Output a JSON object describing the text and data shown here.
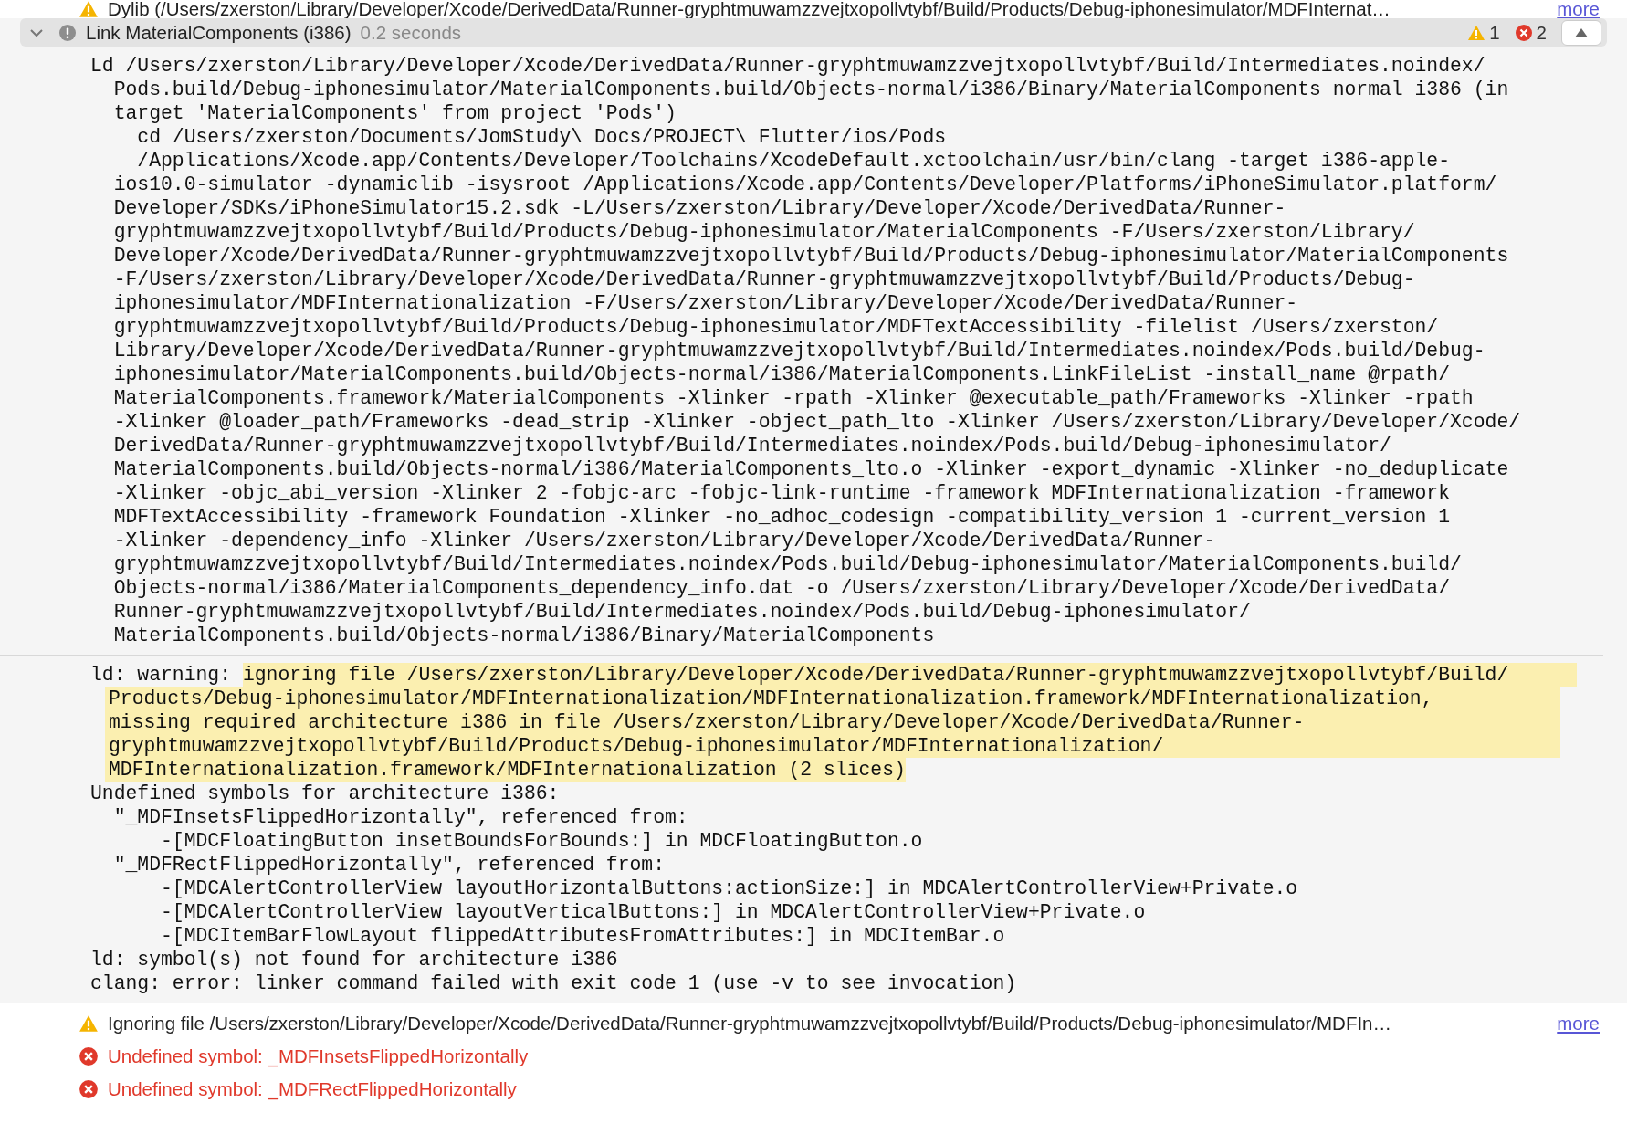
{
  "top_issue": {
    "kind": "warning",
    "text": "Dylib (/Users/zxerston/Library/Developer/Xcode/DerivedData/Runner-gryphtmuwamzzvejtxopollvtybf/Build/Products/Debug-iphonesimulator/MDFInternat…",
    "link": "more"
  },
  "step": {
    "expanded": true,
    "title": "Link MaterialComponents (i386)",
    "duration": "0.2 seconds",
    "warning_count": "1",
    "error_count": "2"
  },
  "command": {
    "lines": [
      "Ld /Users/zxerston/Library/Developer/Xcode/DerivedData/Runner-gryphtmuwamzzvejtxopollvtybf/Build/Intermediates.noindex/",
      "  Pods.build/Debug-iphonesimulator/MaterialComponents.build/Objects-normal/i386/Binary/MaterialComponents normal i386 (in",
      "  target 'MaterialComponents' from project 'Pods')",
      "    cd /Users/zxerston/Documents/JomStudy\\ Docs/PROJECT\\ Flutter/ios/Pods",
      "    /Applications/Xcode.app/Contents/Developer/Toolchains/XcodeDefault.xctoolchain/usr/bin/clang -target i386-apple-",
      "  ios10.0-simulator -dynamiclib -isysroot /Applications/Xcode.app/Contents/Developer/Platforms/iPhoneSimulator.platform/",
      "  Developer/SDKs/iPhoneSimulator15.2.sdk -L/Users/zxerston/Library/Developer/Xcode/DerivedData/Runner-",
      "  gryphtmuwamzzvejtxopollvtybf/Build/Products/Debug-iphonesimulator/MaterialComponents -F/Users/zxerston/Library/",
      "  Developer/Xcode/DerivedData/Runner-gryphtmuwamzzvejtxopollvtybf/Build/Products/Debug-iphonesimulator/MaterialComponents",
      "  -F/Users/zxerston/Library/Developer/Xcode/DerivedData/Runner-gryphtmuwamzzvejtxopollvtybf/Build/Products/Debug-",
      "  iphonesimulator/MDFInternationalization -F/Users/zxerston/Library/Developer/Xcode/DerivedData/Runner-",
      "  gryphtmuwamzzvejtxopollvtybf/Build/Products/Debug-iphonesimulator/MDFTextAccessibility -filelist /Users/zxerston/",
      "  Library/Developer/Xcode/DerivedData/Runner-gryphtmuwamzzvejtxopollvtybf/Build/Intermediates.noindex/Pods.build/Debug-",
      "  iphonesimulator/MaterialComponents.build/Objects-normal/i386/MaterialComponents.LinkFileList -install_name @rpath/",
      "  MaterialComponents.framework/MaterialComponents -Xlinker -rpath -Xlinker @executable_path/Frameworks -Xlinker -rpath",
      "  -Xlinker @loader_path/Frameworks -dead_strip -Xlinker -object_path_lto -Xlinker /Users/zxerston/Library/Developer/Xcode/",
      "  DerivedData/Runner-gryphtmuwamzzvejtxopollvtybf/Build/Intermediates.noindex/Pods.build/Debug-iphonesimulator/",
      "  MaterialComponents.build/Objects-normal/i386/MaterialComponents_lto.o -Xlinker -export_dynamic -Xlinker -no_deduplicate",
      "  -Xlinker -objc_abi_version -Xlinker 2 -fobjc-arc -fobjc-link-runtime -framework MDFInternationalization -framework",
      "  MDFTextAccessibility -framework Foundation -Xlinker -no_adhoc_codesign -compatibility_version 1 -current_version 1",
      "  -Xlinker -dependency_info -Xlinker /Users/zxerston/Library/Developer/Xcode/DerivedData/Runner-",
      "  gryphtmuwamzzvejtxopollvtybf/Build/Intermediates.noindex/Pods.build/Debug-iphonesimulator/MaterialComponents.build/",
      "  Objects-normal/i386/MaterialComponents_dependency_info.dat -o /Users/zxerston/Library/Developer/Xcode/DerivedData/",
      "  Runner-gryphtmuwamzzvejtxopollvtybf/Build/Intermediates.noindex/Pods.build/Debug-iphonesimulator/",
      "  MaterialComponents.build/Objects-normal/i386/Binary/MaterialComponents"
    ]
  },
  "output": {
    "lines": [
      {
        "parts": [
          {
            "text": "ld: warning: ",
            "highlighted": false
          },
          {
            "text": "ignoring file /Users/zxerston/Library/Developer/Xcode/DerivedData/Runner-gryphtmuwamzzvejtxopollvtybf/Build/",
            "highlighted": true
          }
        ]
      },
      {
        "parts": [
          {
            "text": "Products/Debug-iphonesimulator/MDFInternationalization/MDFInternationalization.framework/MDFInternationalization,",
            "highlighted": true
          }
        ]
      },
      {
        "parts": [
          {
            "text": "missing required architecture i386 in file /Users/zxerston/Library/Developer/Xcode/DerivedData/Runner-",
            "highlighted": true
          }
        ]
      },
      {
        "parts": [
          {
            "text": "gryphtmuwamzzvejtxopollvtybf/Build/Products/Debug-iphonesimulator/MDFInternationalization/",
            "highlighted": true
          }
        ]
      },
      {
        "parts": [
          {
            "text": "MDFInternationalization.framework/MDFInternationalization (2 slices)",
            "highlighted": true
          }
        ]
      },
      {
        "parts": [
          {
            "text": "Undefined symbols for architecture i386:",
            "highlighted": false
          }
        ]
      },
      {
        "parts": [
          {
            "text": "  \"_MDFInsetsFlippedHorizontally\", referenced from:",
            "highlighted": false
          }
        ]
      },
      {
        "parts": [
          {
            "text": "      -[MDCFloatingButton insetBoundsForBounds:] in MDCFloatingButton.o",
            "highlighted": false
          }
        ]
      },
      {
        "parts": [
          {
            "text": "  \"_MDFRectFlippedHorizontally\", referenced from:",
            "highlighted": false
          }
        ]
      },
      {
        "parts": [
          {
            "text": "      -[MDCAlertControllerView layoutHorizontalButtons:actionSize:] in MDCAlertControllerView+Private.o",
            "highlighted": false
          }
        ]
      },
      {
        "parts": [
          {
            "text": "      -[MDCAlertControllerView layoutVerticalButtons:] in MDCAlertControllerView+Private.o",
            "highlighted": false
          }
        ]
      },
      {
        "parts": [
          {
            "text": "      -[MDCItemBarFlowLayout flippedAttributesFromAttributes:] in MDCItemBar.o",
            "highlighted": false
          }
        ]
      },
      {
        "parts": [
          {
            "text": "ld: symbol(s) not found for architecture i386",
            "highlighted": false
          }
        ]
      },
      {
        "parts": [
          {
            "text": "clang: error: linker command failed with exit code 1 (use -v to see invocation)",
            "highlighted": false
          }
        ]
      }
    ]
  },
  "issues": [
    {
      "kind": "warning",
      "text": "Ignoring file /Users/zxerston/Library/Developer/Xcode/DerivedData/Runner-gryphtmuwamzzvejtxopollvtybf/Build/Products/Debug-iphonesimulator/MDFIn…",
      "link": "more"
    },
    {
      "kind": "error",
      "text": "Undefined symbol: _MDFInsetsFlippedHorizontally"
    },
    {
      "kind": "error",
      "text": "Undefined symbol: _MDFRectFlippedHorizontally"
    }
  ]
}
